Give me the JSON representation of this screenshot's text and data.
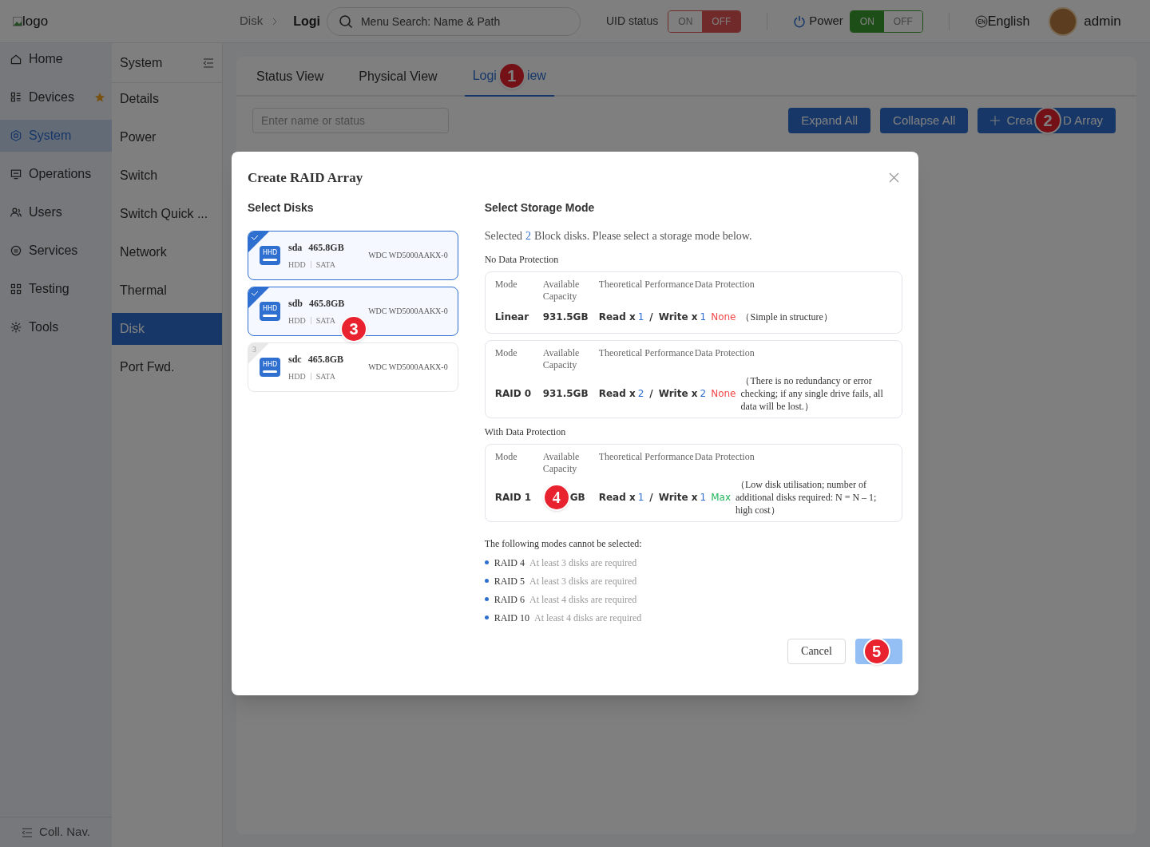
{
  "header": {
    "logo_alt": "logo",
    "breadcrumb": [
      "Disk",
      "Logi"
    ],
    "search": {
      "placeholder": "Menu Search: Name & Path"
    },
    "uid_status": {
      "label": "UID status",
      "options": [
        {
          "label": "ON",
          "selected": false
        },
        {
          "label": "OFF",
          "selected": true
        }
      ]
    },
    "power": {
      "label": "Power",
      "options": [
        {
          "label": "ON",
          "selected": true
        },
        {
          "label": "OFF",
          "selected": false
        }
      ]
    },
    "language": "English",
    "user": "admin"
  },
  "nav": {
    "items": [
      {
        "label": "Home",
        "selected": false,
        "starred": false
      },
      {
        "label": "Devices",
        "selected": false,
        "starred": true
      },
      {
        "label": "System",
        "selected": true,
        "starred": false
      },
      {
        "label": "Operations",
        "selected": false,
        "starred": false
      },
      {
        "label": "Users",
        "selected": false,
        "starred": false
      },
      {
        "label": "Services",
        "selected": false,
        "starred": false
      },
      {
        "label": "Testing",
        "selected": false,
        "starred": false
      },
      {
        "label": "Tools",
        "selected": false,
        "starred": false
      }
    ],
    "footer": "Coll. Nav."
  },
  "subnav": {
    "title": "System",
    "items": [
      {
        "label": "Details",
        "selected": false
      },
      {
        "label": "Power",
        "selected": false
      },
      {
        "label": "Switch",
        "selected": false
      },
      {
        "label": "Switch Quick ...",
        "selected": false
      },
      {
        "label": "Network",
        "selected": false
      },
      {
        "label": "Thermal",
        "selected": false
      },
      {
        "label": "Disk",
        "selected": true
      },
      {
        "label": "Port Fwd.",
        "selected": false
      }
    ]
  },
  "tabs": [
    {
      "label": "Status View",
      "selected": false
    },
    {
      "label": "Physical View",
      "selected": false
    },
    {
      "label": "Logi",
      "label_after": "iew",
      "callout": "1",
      "selected": true
    }
  ],
  "filter": {
    "placeholder": "Enter name or status"
  },
  "actions": [
    {
      "label": "Expand All"
    },
    {
      "label": "Collapse All"
    },
    {
      "label": "Crea",
      "label_after": "D Array",
      "callout": "2",
      "plus": true
    }
  ],
  "dialog": {
    "title": "Create RAID Array",
    "disks_title": "Select Disks",
    "disk_callout": "3",
    "disks": [
      {
        "name": "sda",
        "size": "465.8GB",
        "type": "HDD",
        "bus": "SATA",
        "model": "WDC WD5000AAKX-0",
        "icon_label": "HHD",
        "checked": true
      },
      {
        "name": "sdb",
        "size": "465.8GB",
        "type": "HDD",
        "bus": "SATA",
        "model": "WDC WD5000AAKX-0",
        "icon_label": "HHD",
        "checked": true
      },
      {
        "name": "sdc",
        "size": "465.8GB",
        "type": "HDD",
        "bus": "SATA",
        "model": "WDC WD5000AAKX-0",
        "icon_label": "HHD",
        "checked": false,
        "corner_label": "3"
      }
    ],
    "mode_title": "Select Storage Mode",
    "summary_before": "Selected",
    "summary_count": "2",
    "summary_after": "Block disks. Please select a storage mode below.",
    "groups": [
      {
        "title": "No Data Protection",
        "modes": [
          {
            "headers": [
              "Mode",
              "Available Capacity",
              "Theoretical Performance",
              "Data Protection"
            ],
            "mode": "Linear",
            "capacity": "931.5GB",
            "read_label": "Read x",
            "read": "1",
            "separator": "/",
            "write_label": "Write x",
            "write": "1",
            "protection": "None",
            "color": "#f04848",
            "note": "（Simple in structure）"
          },
          {
            "headers": [
              "Mode",
              "Available Capacity",
              "Theoretical Performance",
              "Data Protection"
            ],
            "mode": "RAID 0",
            "capacity": "931.5GB",
            "read_label": "Read x",
            "read": "2",
            "separator": "/",
            "write_label": "Write x",
            "write": "2",
            "protection": "None",
            "color": "#f04848",
            "note": "（There is no redundancy or error checking; if any single drive fails, all data will be lost.）"
          }
        ]
      },
      {
        "title": "With Data Protection",
        "modes": [
          {
            "headers": [
              "Mode",
              "Available Capacity",
              "Theoretical Performance",
              "Data Protection"
            ],
            "mode": "RAID 1",
            "capacity": "GB",
            "callout": "4",
            "read_label": "Read x",
            "read": "1",
            "separator": "/",
            "write_label": "Write x",
            "write": "1",
            "protection": "Max",
            "color": "#22b45a",
            "note": "（Low disk utilisation; number of additional disks required: N = N – 1; high cost）"
          }
        ]
      }
    ],
    "unavailable_title": "The following modes cannot be selected:",
    "unavailable": [
      {
        "mode": "RAID 4",
        "reason": "At least 3 disks are required"
      },
      {
        "mode": "RAID 5",
        "reason": "At least 3 disks are required"
      },
      {
        "mode": "RAID 6",
        "reason": "At least 4 disks are required"
      },
      {
        "mode": "RAID 10",
        "reason": "At least 4 disks are required"
      }
    ],
    "cancel": "Cancel",
    "confirm_callout": "5"
  }
}
